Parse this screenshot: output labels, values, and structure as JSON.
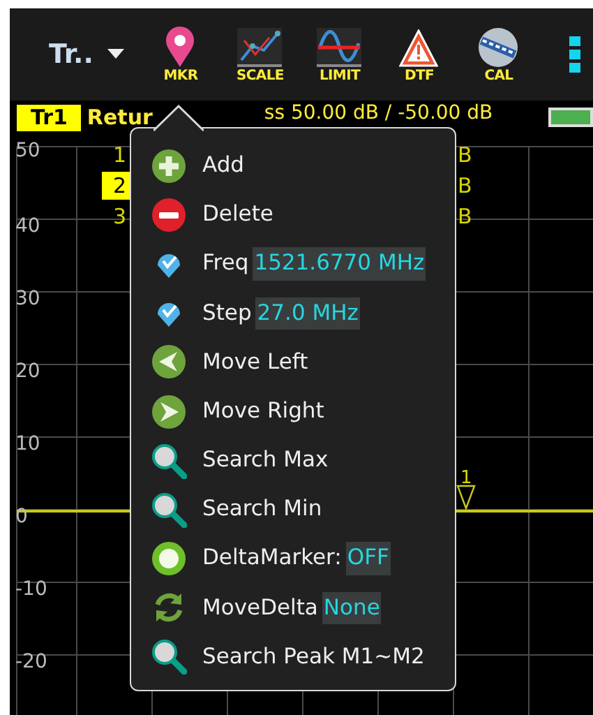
{
  "toolbar": {
    "trace_selector": "Tr..",
    "tools": [
      {
        "kind": "marker",
        "label": "MKR"
      },
      {
        "kind": "scale",
        "label": "SCALE"
      },
      {
        "kind": "limit",
        "label": "LIMIT"
      },
      {
        "kind": "dtf",
        "label": "DTF"
      },
      {
        "kind": "cal",
        "label": "CAL"
      }
    ]
  },
  "header": {
    "trace": "Tr1",
    "title_start": "Retur",
    "title_end": "ss 50.00 dB / -50.00 dB"
  },
  "chart": {
    "y_labels": [
      "50",
      "40",
      "30",
      "20",
      "10",
      "0",
      "-10",
      "-20"
    ],
    "marker_rows": [
      {
        "number": "1",
        "unit": "B",
        "selected": false
      },
      {
        "number": "2",
        "unit": "B",
        "selected": true
      },
      {
        "number": "3",
        "unit": "B",
        "selected": false
      }
    ],
    "marker_label": "1"
  },
  "menu": {
    "items": [
      {
        "kind": "add",
        "label": "Add"
      },
      {
        "kind": "delete",
        "label": "Delete"
      },
      {
        "kind": "pin",
        "label": "Freq",
        "value": "1521.6770 MHz"
      },
      {
        "kind": "pin",
        "label": "Step",
        "value": "27.0 MHz"
      },
      {
        "kind": "left",
        "label": "Move Left"
      },
      {
        "kind": "right",
        "label": "Move Right"
      },
      {
        "kind": "search",
        "label": "Search Max"
      },
      {
        "kind": "search",
        "label": "Search Min"
      },
      {
        "kind": "dot",
        "label": "DeltaMarker:",
        "value": "OFF"
      },
      {
        "kind": "cycle",
        "label": "MoveDelta",
        "value": "None"
      },
      {
        "kind": "search",
        "label": "Search Peak M1~M2"
      }
    ]
  }
}
